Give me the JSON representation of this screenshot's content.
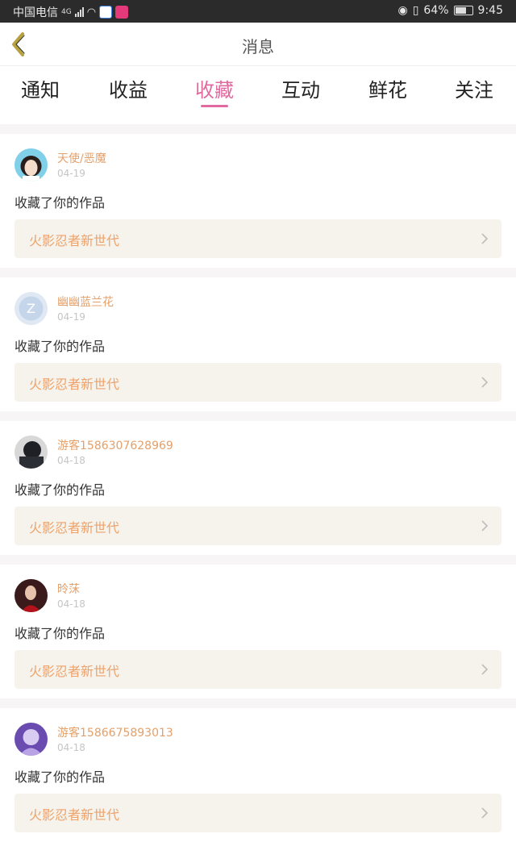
{
  "status_bar": {
    "carrier": "中国电信",
    "network": "4G",
    "battery": "64%",
    "time": "9:45"
  },
  "header": {
    "title": "消息"
  },
  "tabs": [
    {
      "label": "通知",
      "active": false
    },
    {
      "label": "收益",
      "active": false
    },
    {
      "label": "收藏",
      "active": true
    },
    {
      "label": "互动",
      "active": false
    },
    {
      "label": "鲜花",
      "active": false
    },
    {
      "label": "关注",
      "active": false
    }
  ],
  "colors": {
    "accent": "#e06a9f",
    "username": "#e4a06a",
    "work_title": "#eea26b"
  },
  "items": [
    {
      "username": "天使/恶魔",
      "date": "04-19",
      "action": "收藏了你的作品",
      "work": "火影忍者新世代"
    },
    {
      "username": "幽幽蓝兰花",
      "date": "04-19",
      "action": "收藏了你的作品",
      "work": "火影忍者新世代"
    },
    {
      "username": "游客1586307628969",
      "date": "04-18",
      "action": "收藏了你的作品",
      "work": "火影忍者新世代"
    },
    {
      "username": "昤莯",
      "date": "04-18",
      "action": "收藏了你的作品",
      "work": "火影忍者新世代"
    },
    {
      "username": "游客1586675893013",
      "date": "04-18",
      "action": "收藏了你的作品",
      "work": "火影忍者新世代"
    }
  ]
}
